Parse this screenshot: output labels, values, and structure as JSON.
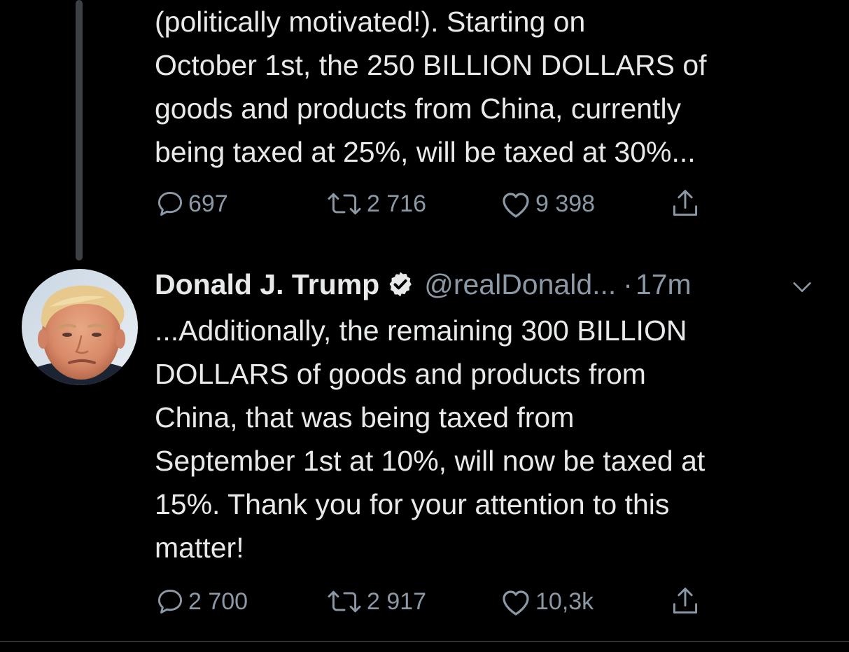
{
  "tweet_1": {
    "text": "(politically motivated!). Starting on\nOctober 1st, the 250 BILLION DOLLARS of\ngoods and products from China, currently\nbeing taxed at 25%, will be taxed at 30%...",
    "stats": {
      "replies": "697",
      "retweets": "2 716",
      "likes": "9 398"
    }
  },
  "tweet_2": {
    "author_name": "Donald J. Trump",
    "handle": "@realDonald...",
    "separator": "·",
    "time": "17m",
    "text": "...Additionally, the remaining 300 BILLION\nDOLLARS of goods and products from\nChina, that was being taxed from\nSeptember 1st at 10%, will now be taxed at\n15%. Thank you for your attention to this\nmatter!",
    "stats": {
      "replies": "2 700",
      "retweets": "2 917",
      "likes": "10,3k"
    }
  },
  "icons": {
    "reply": "reply-icon",
    "retweet": "retweet-icon",
    "like": "heart-icon",
    "share": "share-icon",
    "verified": "verified-badge-icon",
    "caret": "chevron-down-icon"
  },
  "colors": {
    "background": "#000000",
    "text": "#e7e9ea",
    "secondary": "#8b98a5",
    "thread_line": "#3d4145"
  }
}
